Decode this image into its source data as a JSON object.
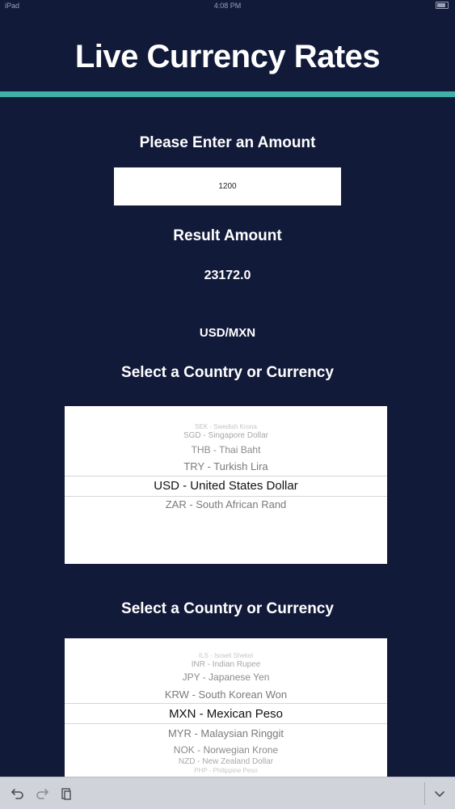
{
  "status_bar": {
    "left": "iPad",
    "time": "4:08 PM",
    "battery_icon": "battery-icon"
  },
  "header": {
    "title": "Live Currency Rates",
    "accent_color": "#3fb1a6"
  },
  "amount_section": {
    "label": "Please Enter an Amount",
    "input_value": "1200"
  },
  "result_section": {
    "label": "Result Amount",
    "value": "23172.0",
    "pair": "USD/MXN"
  },
  "from_picker": {
    "label": "Select a Country or Currency",
    "rows": [
      "SEK - Swedish Krona",
      "SGD - Singapore Dollar",
      "THB - Thai Baht",
      "TRY - Turkish Lira",
      "USD - United States Dollar",
      "ZAR - South African Rand"
    ],
    "selected": "USD - United States Dollar"
  },
  "to_picker": {
    "label": "Select a Country or Currency",
    "rows": [
      "ILS - Israeli Shekel",
      "INR - Indian Rupee",
      "JPY - Japanese Yen",
      "KRW - South Korean Won",
      "MXN - Mexican Peso",
      "MYR - Malaysian Ringgit",
      "NOK - Norwegian Krone",
      "NZD - New Zealand Dollar",
      "PHP - Philippine Peso"
    ],
    "selected": "MXN - Mexican Peso"
  },
  "keyboard_toolbar": {
    "undo_icon": "undo-icon",
    "redo_icon": "redo-icon",
    "paste_icon": "paste-icon",
    "dismiss_icon": "chevron-down-icon"
  }
}
